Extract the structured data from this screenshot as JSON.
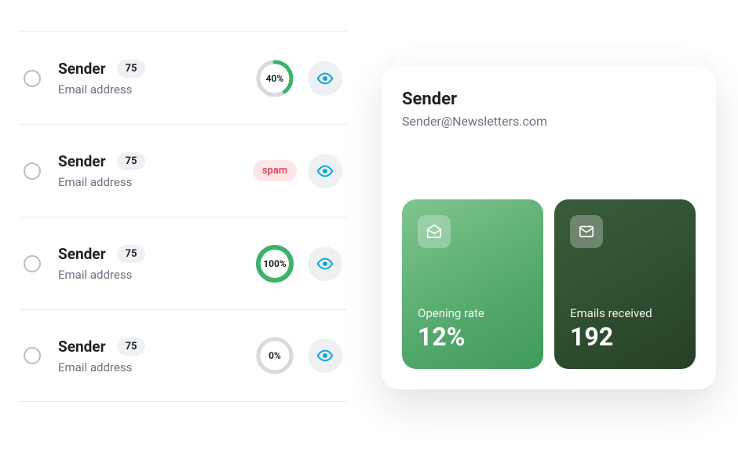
{
  "list": {
    "items": [
      {
        "name": "Sender",
        "sub": "Email address",
        "count": "75",
        "ring_pct": 40,
        "ring_label": "40%",
        "spam": false
      },
      {
        "name": "Sender",
        "sub": "Email address",
        "count": "75",
        "spam": true,
        "spam_label": "spam"
      },
      {
        "name": "Sender",
        "sub": "Email address",
        "count": "75",
        "ring_pct": 100,
        "ring_label": "100%",
        "spam": false
      },
      {
        "name": "Sender",
        "sub": "Email address",
        "count": "75",
        "ring_pct": 0,
        "ring_label": "0%",
        "spam": false
      }
    ]
  },
  "detail": {
    "title": "Sender",
    "email": "Sender@Newsletters.com",
    "tiles": {
      "opening": {
        "label": "Opening rate",
        "value": "12%"
      },
      "received": {
        "label": "Emails received",
        "value": "192"
      }
    }
  },
  "colors": {
    "eye": "#07a7d6",
    "ring_progress": "#3fb26a"
  }
}
